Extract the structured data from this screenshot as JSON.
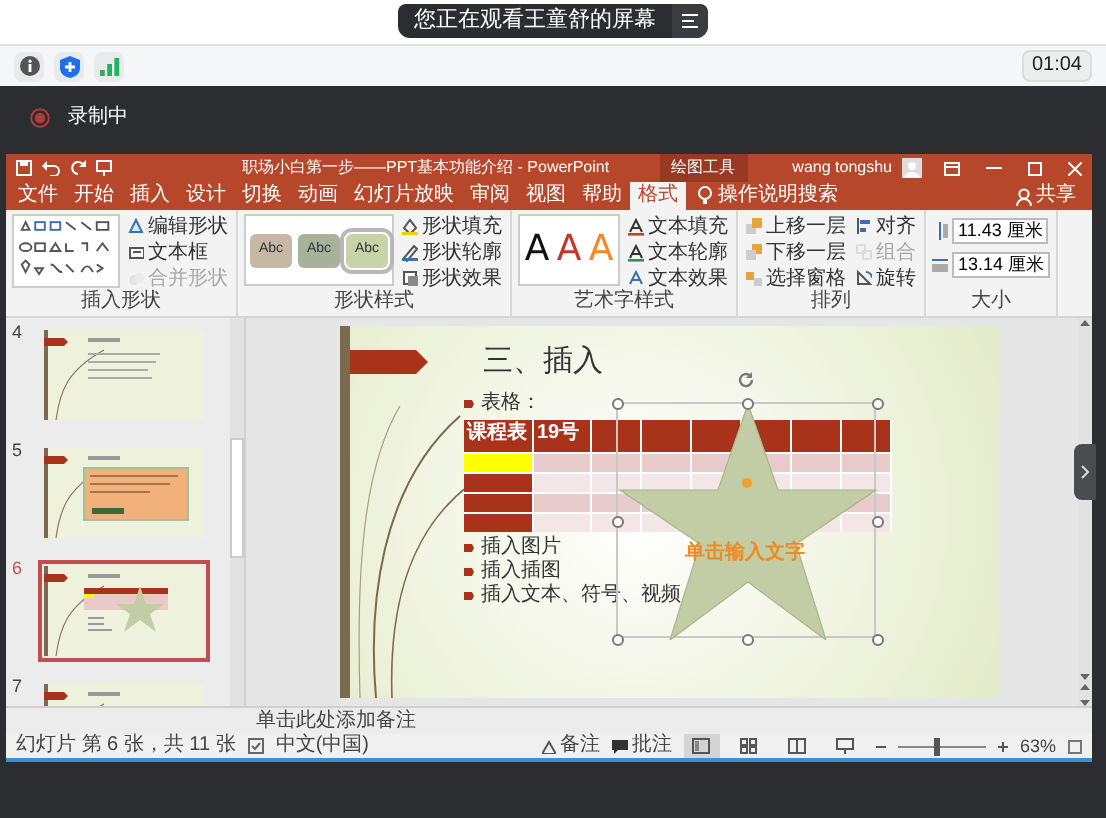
{
  "share_banner": {
    "text": "您正在观看王童舒的屏幕"
  },
  "meeting_toolbar": {
    "timer": "01:04"
  },
  "recording": {
    "label": "录制中"
  },
  "powerpoint": {
    "title": "职场小白第一步——PPT基本功能介绍 - PowerPoint",
    "context_group": "绘图工具",
    "user": "wang tongshu",
    "tabs": [
      {
        "label": "文件",
        "selected": false
      },
      {
        "label": "开始",
        "selected": false
      },
      {
        "label": "插入",
        "selected": false
      },
      {
        "label": "设计",
        "selected": false
      },
      {
        "label": "切换",
        "selected": false
      },
      {
        "label": "动画",
        "selected": false
      },
      {
        "label": "幻灯片放映",
        "selected": false
      },
      {
        "label": "审阅",
        "selected": false
      },
      {
        "label": "视图",
        "selected": false
      },
      {
        "label": "帮助",
        "selected": false
      },
      {
        "label": "格式",
        "selected": true
      }
    ],
    "tell_me": "操作说明搜索",
    "share": "共享",
    "ribbon": [
      {
        "kind": "shapes",
        "label": "插入形状",
        "commands": [
          {
            "label": "编辑形状",
            "disabled": false
          },
          {
            "label": "文本框",
            "disabled": false
          },
          {
            "label": "合并形状",
            "disabled": true
          }
        ]
      },
      {
        "kind": "shape_styles",
        "label": "形状样式",
        "styles": [
          {
            "text": "Abc",
            "color": "#c5b8a5",
            "selected": false
          },
          {
            "text": "Abc",
            "color": "#a7b29a",
            "selected": false
          },
          {
            "text": "Abc",
            "color": "#c8d3a8",
            "selected": true
          }
        ],
        "commands": [
          {
            "label": "形状填充",
            "disabled": false
          },
          {
            "label": "形状轮廓",
            "disabled": false
          },
          {
            "label": "形状效果",
            "disabled": false
          }
        ]
      },
      {
        "kind": "wordart",
        "label": "艺术字样式",
        "styles": [
          {
            "text": "A",
            "color": "#111111"
          },
          {
            "text": "A",
            "color": "#c0392b"
          },
          {
            "text": "A",
            "color": "#f08a24"
          }
        ],
        "commands": [
          {
            "label": "文本填充",
            "disabled": false
          },
          {
            "label": "文本轮廓",
            "disabled": false
          },
          {
            "label": "文本效果",
            "disabled": false
          }
        ]
      },
      {
        "kind": "arrange",
        "label": "排列",
        "commands": [
          {
            "label": "上移一层",
            "disabled": false
          },
          {
            "label": "下移一层",
            "disabled": false
          },
          {
            "label": "选择窗格",
            "disabled": false
          },
          {
            "label": "对齐",
            "disabled": false
          },
          {
            "label": "组合",
            "disabled": true
          },
          {
            "label": "旋转",
            "disabled": false
          }
        ]
      },
      {
        "kind": "size",
        "label": "大小",
        "fields": [
          {
            "value": "11.43 厘米"
          },
          {
            "value": "13.14 厘米"
          }
        ]
      }
    ],
    "thumbnails": [
      {
        "number": "4",
        "kind": "bullets",
        "selected": false
      },
      {
        "number": "5",
        "kind": "box",
        "selected": false
      },
      {
        "number": "6",
        "kind": "star",
        "selected": true
      },
      {
        "number": "7",
        "kind": "bullets",
        "selected": false
      }
    ],
    "slide": {
      "title": "三、插入",
      "bullets_before": [
        "表格："
      ],
      "table_header": [
        "课程表",
        "19号"
      ],
      "star_text": "单击输入文字",
      "bullets_after": [
        "插入图片",
        "插入插图",
        "插入文本、符号、视频"
      ]
    },
    "notes": {
      "placeholder": "单击此处添加备注"
    },
    "status_bar": {
      "slide_info": "幻灯片 第 6 张，共 11 张",
      "language": "中文(中国)",
      "notes": "备注",
      "comments": "批注",
      "views": [
        {
          "kind": "normal",
          "selected": true
        },
        {
          "kind": "sorter",
          "selected": false
        },
        {
          "kind": "reading",
          "selected": false
        },
        {
          "kind": "slideshow",
          "selected": false
        }
      ],
      "zoom": {
        "level": 0.45,
        "text": "63%"
      }
    }
  }
}
